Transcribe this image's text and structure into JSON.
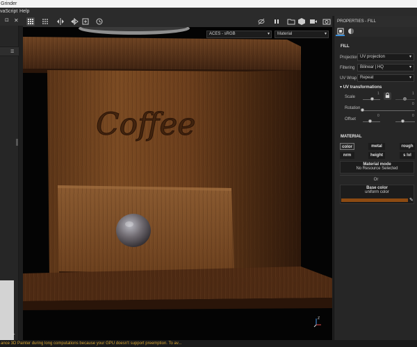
{
  "window": {
    "title": "Grinder"
  },
  "menu": {
    "items": [
      "vaScript",
      "Help"
    ]
  },
  "left_toolbar": {
    "pin": "⊡",
    "close": "✕"
  },
  "viewport": {
    "colorspace": "ACES - sRGB",
    "display_mode": "Material",
    "engraved_text": "Coffee",
    "axis_label": "Z"
  },
  "panel": {
    "title": "PROPERTIES - FILL",
    "fill": {
      "header": "FILL",
      "projection_label": "Projection",
      "projection_value": "UV projection",
      "filtering_label": "Filtering",
      "filtering_value": "Bilinear | HQ",
      "uvwrap_label": "UV Wrap",
      "uvwrap_value": "Repeat"
    },
    "uv": {
      "header": "UV transformations",
      "scale_label": "Scale",
      "scale_values": [
        "1",
        "1"
      ],
      "rotation_label": "Rotation",
      "rotation_value": "0",
      "offset_label": "Offset",
      "offset_values": [
        "0",
        "0"
      ]
    },
    "material": {
      "header": "MATERIAL",
      "channels": [
        "color",
        "metal",
        "rough",
        "nrm",
        "height",
        "s lvl"
      ],
      "mode_label": "Material mode",
      "mode_value": "No Resource Selected",
      "or_label": "Or",
      "base_label": "Base color",
      "base_value": "uniform color",
      "base_swatch": "#8c4a12"
    }
  },
  "status": {
    "text": "ance 3D Painter during long computations because your GPU doesn't support preemption. To av..."
  },
  "colors": {
    "accent": "#3a8ed8",
    "warning_text": "#d8a636"
  }
}
